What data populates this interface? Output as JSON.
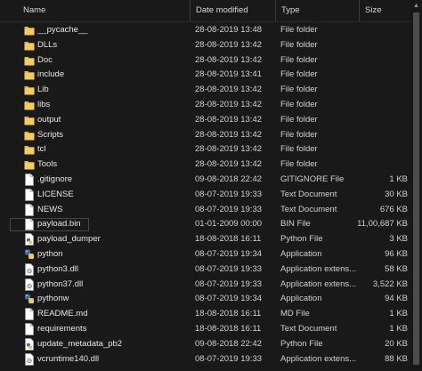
{
  "columns": {
    "name": "Name",
    "date": "Date modified",
    "type": "Type",
    "size": "Size"
  },
  "colors": {
    "folder": "#e8b53c",
    "highlight_border": "#c01010",
    "python_blue": "#3a6fb0",
    "python_yellow": "#f0c93a"
  },
  "files": [
    {
      "name": "__pycache__",
      "date": "28-08-2019 13:48",
      "type": "File folder",
      "size": "",
      "icon": "folder-icon"
    },
    {
      "name": "DLLs",
      "date": "28-08-2019 13:42",
      "type": "File folder",
      "size": "",
      "icon": "folder-icon"
    },
    {
      "name": "Doc",
      "date": "28-08-2019 13:42",
      "type": "File folder",
      "size": "",
      "icon": "folder-icon"
    },
    {
      "name": "include",
      "date": "28-08-2019 13:41",
      "type": "File folder",
      "size": "",
      "icon": "folder-icon"
    },
    {
      "name": "Lib",
      "date": "28-08-2019 13:42",
      "type": "File folder",
      "size": "",
      "icon": "folder-icon"
    },
    {
      "name": "libs",
      "date": "28-08-2019 13:42",
      "type": "File folder",
      "size": "",
      "icon": "folder-icon"
    },
    {
      "name": "output",
      "date": "28-08-2019 13:42",
      "type": "File folder",
      "size": "",
      "icon": "folder-icon"
    },
    {
      "name": "Scripts",
      "date": "28-08-2019 13:42",
      "type": "File folder",
      "size": "",
      "icon": "folder-icon"
    },
    {
      "name": "tcl",
      "date": "28-08-2019 13:42",
      "type": "File folder",
      "size": "",
      "icon": "folder-icon"
    },
    {
      "name": "Tools",
      "date": "28-08-2019 13:42",
      "type": "File folder",
      "size": "",
      "icon": "folder-icon"
    },
    {
      "name": ".gitignore",
      "date": "09-08-2018 22:42",
      "type": "GITIGNORE File",
      "size": "1 KB",
      "icon": "document-icon"
    },
    {
      "name": "LICENSE",
      "date": "08-07-2019 19:33",
      "type": "Text Document",
      "size": "30 KB",
      "icon": "document-icon"
    },
    {
      "name": "NEWS",
      "date": "08-07-2019 19:33",
      "type": "Text Document",
      "size": "676 KB",
      "icon": "document-icon"
    },
    {
      "name": "payload.bin",
      "date": "01-01-2009 00:00",
      "type": "BIN File",
      "size": "11,00,687 KB",
      "icon": "document-icon"
    },
    {
      "name": "payload_dumper",
      "date": "18-08-2018 16:11",
      "type": "Python File",
      "size": "3 KB",
      "icon": "python-file-icon"
    },
    {
      "name": "python",
      "date": "08-07-2019 19:34",
      "type": "Application",
      "size": "96 KB",
      "icon": "python-app-icon"
    },
    {
      "name": "python3.dll",
      "date": "08-07-2019 19:33",
      "type": "Application extens...",
      "size": "58 KB",
      "icon": "dll-icon"
    },
    {
      "name": "python37.dll",
      "date": "08-07-2019 19:33",
      "type": "Application extens...",
      "size": "3,522 KB",
      "icon": "dll-icon"
    },
    {
      "name": "pythonw",
      "date": "08-07-2019 19:34",
      "type": "Application",
      "size": "94 KB",
      "icon": "python-app-icon"
    },
    {
      "name": "README.md",
      "date": "18-08-2018 16:11",
      "type": "MD File",
      "size": "1 KB",
      "icon": "document-icon"
    },
    {
      "name": "requirements",
      "date": "18-08-2018 16:11",
      "type": "Text Document",
      "size": "1 KB",
      "icon": "document-icon"
    },
    {
      "name": "update_metadata_pb2",
      "date": "09-08-2018 22:42",
      "type": "Python File",
      "size": "20 KB",
      "icon": "python-file-icon"
    },
    {
      "name": "vcruntime140.dll",
      "date": "08-07-2019 19:33",
      "type": "Application extens...",
      "size": "88 KB",
      "icon": "dll-icon"
    }
  ]
}
